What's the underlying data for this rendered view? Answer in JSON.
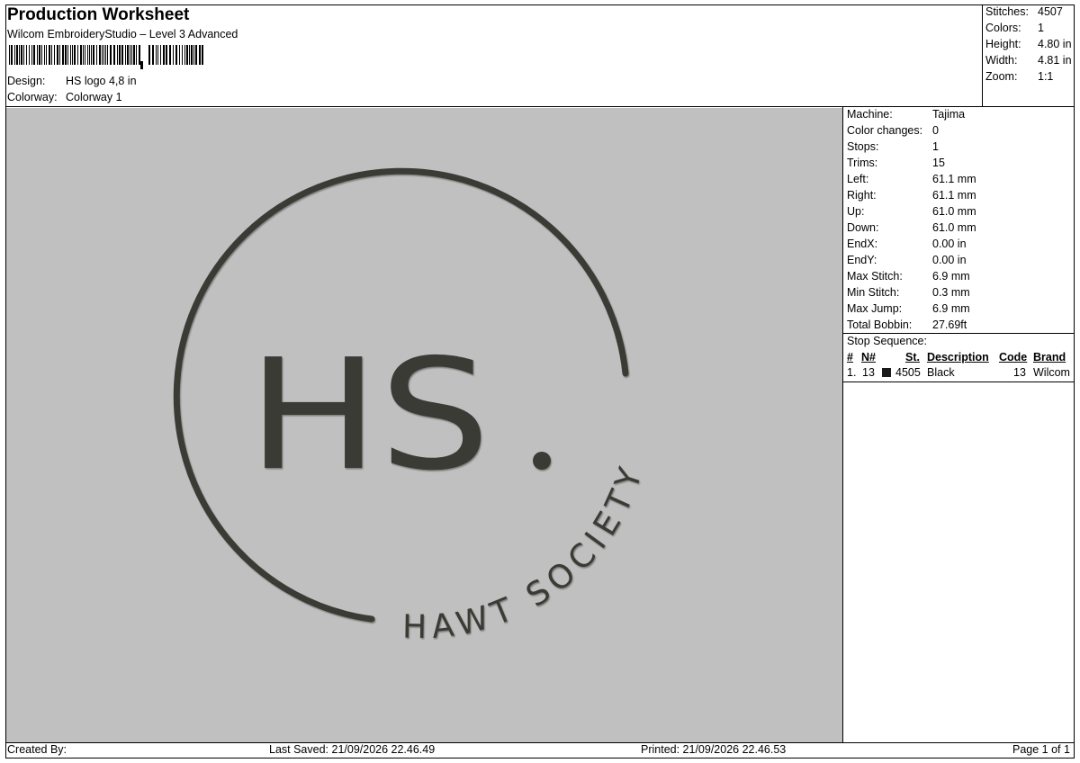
{
  "header": {
    "title": "Production Worksheet",
    "software": "Wilcom EmbroideryStudio – Level 3 Advanced",
    "design_label": "Design:",
    "design_value": "HS logo 4,8 in",
    "colorway_label": "Colorway:",
    "colorway_value": "Colorway 1"
  },
  "summary": [
    {
      "label": "Stitches:",
      "value": "4507"
    },
    {
      "label": "Colors:",
      "value": "1"
    },
    {
      "label": "Height:",
      "value": "4.80 in"
    },
    {
      "label": "Width:",
      "value": "4.81 in"
    },
    {
      "label": "Zoom:",
      "value": "1:1"
    }
  ],
  "machine_info": [
    {
      "label": "Machine:",
      "value": "Tajima"
    },
    {
      "label": "Color changes:",
      "value": "0"
    },
    {
      "label": "Stops:",
      "value": "1"
    },
    {
      "label": "Trims:",
      "value": "15"
    },
    {
      "label": "Left:",
      "value": "61.1 mm"
    },
    {
      "label": "Right:",
      "value": "61.1 mm"
    },
    {
      "label": "Up:",
      "value": "61.0 mm"
    },
    {
      "label": "Down:",
      "value": "61.0 mm"
    },
    {
      "label": "EndX:",
      "value": "0.00 in"
    },
    {
      "label": "EndY:",
      "value": "0.00 in"
    },
    {
      "label": "Max Stitch:",
      "value": "6.9 mm"
    },
    {
      "label": "Min Stitch:",
      "value": "0.3 mm"
    },
    {
      "label": "Max Jump:",
      "value": "6.9 mm"
    },
    {
      "label": "Total Bobbin:",
      "value": "27.69ft"
    }
  ],
  "stop_sequence": {
    "title": "Stop Sequence:",
    "headers": [
      "#",
      "N#",
      "St.",
      "Description",
      "Code",
      "Brand"
    ],
    "rows": [
      {
        "index": "1.",
        "needle": "13",
        "stitches": "4505",
        "description": "Black",
        "code": "13",
        "brand": "Wilcom",
        "swatch": "#1a1a1a"
      }
    ]
  },
  "design": {
    "monogram": "HS",
    "tagline": "HAWT SOCIETY",
    "thread_color": "#3a3b36"
  },
  "footer": {
    "created_by": "Created By:",
    "last_saved": "Last Saved: 21/09/2026 22.46.49",
    "printed": "Printed: 21/09/2026 22.46.53",
    "page": "Page 1 of 1"
  }
}
